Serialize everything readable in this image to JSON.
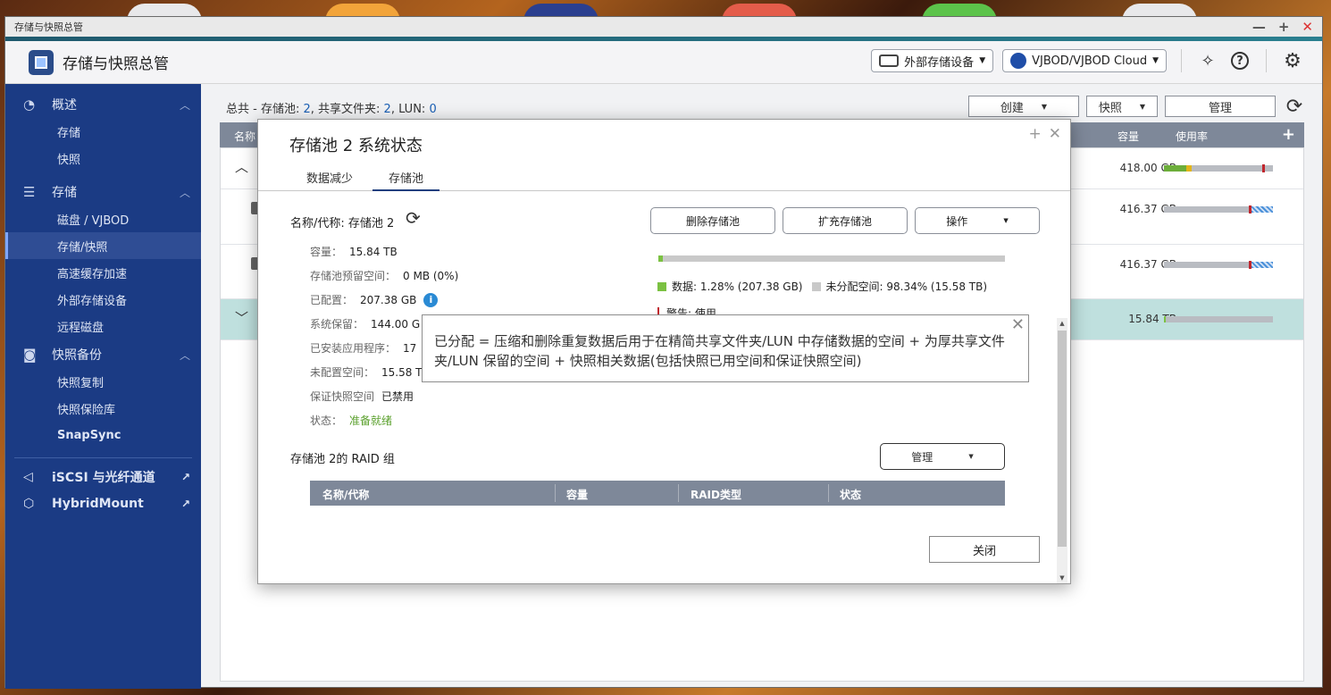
{
  "window": {
    "title": "存储与快照总管"
  },
  "app": {
    "title": "存储与快照总管"
  },
  "header": {
    "external_storage_label": "外部存储设备",
    "vjbod_label": "VJBOD/VJBOD Cloud"
  },
  "sidebar": {
    "overview": "概述",
    "overview_items": [
      "存储",
      "快照"
    ],
    "storage": "存储",
    "storage_items": [
      "磁盘 / VJBOD",
      "存储/快照",
      "高速缓存加速",
      "外部存储设备",
      "远程磁盘"
    ],
    "snapshot_backup": "快照备份",
    "snapshot_items": [
      "快照复制",
      "快照保险库",
      "SnapSync"
    ],
    "iscsi": "iSCSI 与光纤通道",
    "hybridmount": "HybridMount"
  },
  "summary": {
    "prefix": "总共 - 存储池: ",
    "pools": "2",
    "shares_label": ", 共享文件夹: ",
    "shares": "2",
    "lun_label": ", LUN: ",
    "luns": "0"
  },
  "toolbar": {
    "create": "创建",
    "snapshot": "快照",
    "manage": "管理"
  },
  "grid": {
    "columns": {
      "name": "名称",
      "capacity": "容量",
      "usage": "使用率"
    },
    "rows": [
      {
        "capacity": "418.00 GB",
        "usage_fill": 0.25
      },
      {
        "capacity": "416.37 GB",
        "usage_fill": 0.8
      },
      {
        "capacity": "416.37 GB",
        "usage_fill": 0.8
      },
      {
        "capacity": "15.84 TB",
        "usage_fill": 0.013
      }
    ]
  },
  "dialog": {
    "title": "存储池 2 系统状态",
    "tabs": [
      "数据减少",
      "存储池"
    ],
    "name_label": "名称/代称: 存储池 2",
    "info": [
      {
        "label": "容量：",
        "value": "15.84 TB"
      },
      {
        "label": "存储池预留空间：",
        "value": "0 MB (0%)"
      },
      {
        "label": "已配置：",
        "value": "207.38 GB"
      },
      {
        "label": "系统保留：",
        "value": "144.00 G"
      },
      {
        "label": "已安装应用程序：",
        "value": "17"
      },
      {
        "label": "未配置空间：",
        "value": "15.58 T"
      },
      {
        "label": "保证快照空间",
        "value": "已禁用"
      },
      {
        "label": "状态：",
        "value": "准备就绪"
      }
    ],
    "buttons": {
      "delete": "删除存储池",
      "expand": "扩充存储池",
      "actions": "操作"
    },
    "capacity_fill": 0.0128,
    "legend": {
      "data": "数据: 1.28% (207.38 GB)",
      "unallocated": "未分配空间: 98.34% (15.58 TB)",
      "warning": "警告: 使用"
    },
    "raid_title": "存储池 2的 RAID 组",
    "raid_manage": "管理",
    "raid_columns": [
      "名称/代称",
      "容量",
      "RAID类型",
      "状态"
    ],
    "close": "关闭"
  },
  "tooltip": {
    "text": "已分配 = 压缩和删除重复数据后用于在精简共享文件夹/LUN 中存储数据的空间 + 为厚共享文件夹/LUN 保留的空间 + 快照相关数据(包括快照已用空间和保证快照空间)"
  },
  "colors": {
    "sidebar": "#1b3b84",
    "accent": "#2a7f8f",
    "data_green": "#7bc142",
    "ok_green": "#5aa02c",
    "info_blue": "#2a8ad4"
  }
}
